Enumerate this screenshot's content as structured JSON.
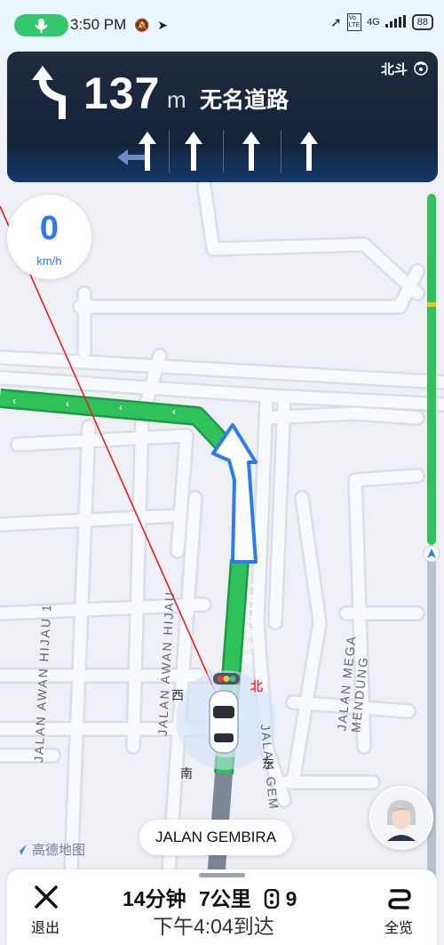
{
  "status_bar": {
    "time": "3:50 PM",
    "network": "4G",
    "battery": "88"
  },
  "maneuver": {
    "distance_value": "137",
    "distance_unit": "m",
    "road_name": "无名道路",
    "positioning": "北斗",
    "lanes": [
      "straight",
      "straight",
      "straight",
      "straight"
    ]
  },
  "speed": {
    "value": "0",
    "unit": "km/h"
  },
  "map": {
    "current_street": "JALAN GEMBIRA",
    "brand": "高德地图",
    "route_street": "GEMBIRA",
    "compass": {
      "north": "北",
      "south": "南",
      "east": "东",
      "west": "西"
    },
    "street_labels": [
      "JALAN AWAN HIJAU 1",
      "JALAN AWAN HIJAU",
      "JALAN MEGA MENDUNG",
      "JALAN GEM"
    ]
  },
  "colors": {
    "route_green": "#2fc15a",
    "accent_blue": "#2c7bf2",
    "nav_card_bg": "#1f2b3e"
  },
  "bottom_bar": {
    "exit_label": "退出",
    "duration": "14分钟",
    "distance": "7公里",
    "traffic_lights": "9",
    "arrival": "下午4:04到达",
    "overview_label": "全览"
  }
}
